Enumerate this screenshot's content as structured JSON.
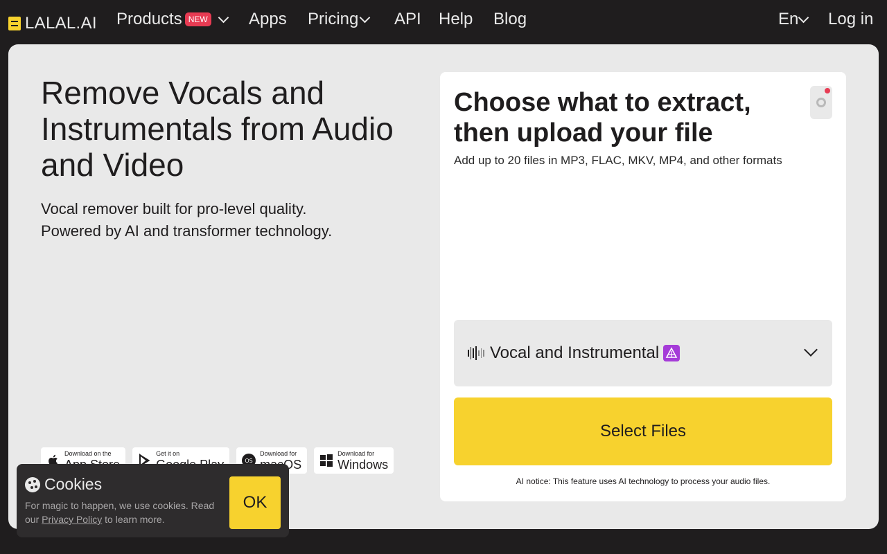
{
  "brand": {
    "name": "LALAL.AI"
  },
  "nav": {
    "products": "Products",
    "new_badge": "NEW",
    "apps": "Apps",
    "pricing": "Pricing",
    "api": "API",
    "help": "Help",
    "blog": "Blog",
    "language": "En",
    "login": "Log in"
  },
  "hero": {
    "title": "Remove Vocals and Instrumentals from Audio and Video",
    "subtitle_line1": "Vocal remover built for pro-level quality.",
    "subtitle_line2": "Powered by AI and transformer technology."
  },
  "stores": [
    {
      "small": "Download on the",
      "big": "App Store",
      "icon": "apple-icon"
    },
    {
      "small": "Get it on",
      "big": "Google Play",
      "icon": "google-play-icon"
    },
    {
      "small": "Download for",
      "big": "macOS",
      "icon": "macos-icon"
    },
    {
      "small": "Download for",
      "big": "Windows",
      "icon": "windows-icon"
    }
  ],
  "uploader": {
    "title": "Choose what to extract, then upload your file",
    "note": "Add up to 20 files in MP3, FLAC, MKV, MP4, and other formats",
    "stem_selected": "Vocal and Instrumental",
    "select_files": "Select Files",
    "ai_notice": "AI notice: This feature uses AI technology to process your audio files."
  },
  "cookies": {
    "title": "Cookies",
    "text_before": "For magic to happen, we use cookies. Read our",
    "link": "Privacy Policy",
    "text_after": "to learn more.",
    "ok": "OK"
  },
  "colors": {
    "background": "#1f1d1e",
    "panel": "#e9e9e9",
    "accent_yellow": "#f7d22e",
    "badge_red": "#e73b53",
    "ai_purple": "#a53bd8"
  }
}
